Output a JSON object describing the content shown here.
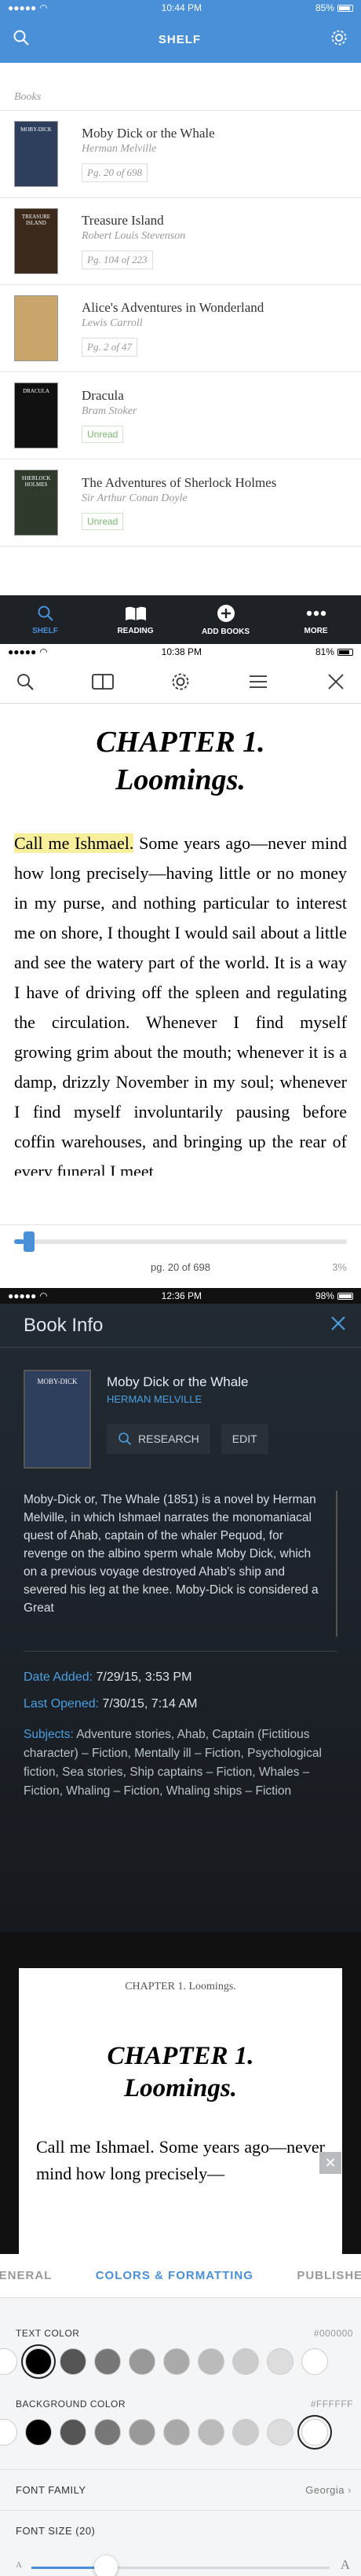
{
  "colors": {
    "accent": "#4a90d9",
    "unread": "#7bb86f",
    "highlight": "#f7ef9c",
    "tabbar": "#1e2227"
  },
  "shelf": {
    "status": {
      "time": "10:44 PM",
      "battery": "85%",
      "battery_level": 0.85
    },
    "title": "SHELF",
    "section_label": "Books",
    "books": [
      {
        "title": "Moby Dick or the Whale",
        "author": "Herman Melville",
        "badge": "Pg. 20 of 698",
        "unread": false,
        "cover_color": "#2d3f5c",
        "cover_text": "MOBY-DICK"
      },
      {
        "title": "Treasure Island",
        "author": "Robert Louis Stevenson",
        "badge": "Pg. 104 of 223",
        "unread": false,
        "cover_color": "#3b2a1c",
        "cover_text": "TREASURE ISLAND"
      },
      {
        "title": "Alice's Adventures in Wonderland",
        "author": "Lewis Carroll",
        "badge": "Pg. 2 of 47",
        "unread": false,
        "cover_color": "#c9a46b",
        "cover_text": ""
      },
      {
        "title": "Dracula",
        "author": "Bram Stoker",
        "badge": "Unread",
        "unread": true,
        "cover_color": "#111111",
        "cover_text": "DRACULA"
      },
      {
        "title": "The Adventures of Sherlock Holmes",
        "author": "Sir Arthur Conan Doyle",
        "badge": "Unread",
        "unread": true,
        "cover_color": "#2f3a2c",
        "cover_text": "SHERLOCK HOLMES"
      }
    ],
    "tabs": [
      {
        "label": "SHELF",
        "icon": "search-icon",
        "active": true
      },
      {
        "label": "READING",
        "icon": "open-book-icon",
        "active": false
      },
      {
        "label": "ADD BOOKS",
        "icon": "plus-circle-icon",
        "active": false
      },
      {
        "label": "MORE",
        "icon": "more-dots-icon",
        "active": false
      }
    ]
  },
  "reader": {
    "status": {
      "time": "10:38 PM",
      "battery": "81%",
      "battery_level": 0.81
    },
    "chapter_line1": "CHAPTER 1.",
    "chapter_line2": "Loomings.",
    "highlight_text": "Call me Ishmael.",
    "body_text": " Some years ago—never mind how long precisely—having little or no money in my purse, and nothing particular to interest me on shore, I thought I would sail about a little and see the watery part of the world. It is a way I have of driving off the spleen and regulating the circulation. Whenever I find myself growing grim about the mouth; whenever it is a damp, drizzly November in my soul; whenever I find myself involuntarily pausing before coffin warehouses, and bringing up the rear of every funeral I meet",
    "page_label": "pg. 20 of 698",
    "percent_label": "3%",
    "progress": 0.03
  },
  "info": {
    "status": {
      "time": "12:36 PM",
      "battery": "98%",
      "battery_level": 0.98
    },
    "header": "Book Info",
    "cover_text": "MOBY-DICK",
    "title": "Moby Dick or the Whale",
    "author": "HERMAN MELVILLE",
    "research_label": "RESEARCH",
    "edit_label": "EDIT",
    "description": "Moby-Dick or, The Whale (1851) is a novel by Herman Melville, in which Ishmael narrates the monomaniacal quest of Ahab, captain of the whaler Pequod, for revenge on the albino sperm whale Moby Dick, which on a previous voyage destroyed Ahab's ship and severed his leg at the knee. Moby-Dick is considered a Great",
    "date_added_label": "Date Added:",
    "date_added": "7/29/15, 3:53 PM",
    "last_opened_label": "Last Opened:",
    "last_opened": "7/30/15, 7:14 AM",
    "subjects_label": "Subjects:",
    "subjects": "Adventure stories, Ahab, Captain (Fictitious character) – Fiction, Mentally ill – Fiction, Psychological fiction, Sea stories, Ship captains – Fiction, Whales – Fiction, Whaling – Fiction, Whaling ships – Fiction"
  },
  "settings": {
    "preview_header": "CHAPTER 1. Loomings.",
    "preview_title1": "CHAPTER 1.",
    "preview_title2": "Loomings.",
    "preview_body": "Call me Ishmael. Some years ago—never mind how long precisely—",
    "tabs": [
      {
        "label": "GENERAL",
        "active": false
      },
      {
        "label": "COLORS & FORMATTING",
        "active": true
      },
      {
        "label": "PUBLISHER",
        "active": false
      }
    ],
    "text_color_label": "TEXT COLOR",
    "text_color_value": "#000000",
    "background_color_label": "BACKGROUND COLOR",
    "background_color_value": "#FFFFFF",
    "text_swatches": [
      "#ffffff",
      "#000000",
      "#555555",
      "#777777",
      "#999999",
      "#aaaaaa",
      "#bbbbbb",
      "#cccccc",
      "#dddddd",
      "#ffffff"
    ],
    "text_selected": 1,
    "bg_swatches": [
      "#ffffff",
      "#000000",
      "#555555",
      "#777777",
      "#999999",
      "#aaaaaa",
      "#bbbbbb",
      "#cccccc",
      "#dddddd",
      "#ffffff"
    ],
    "bg_selected": 9,
    "font_family_label": "FONT FAMILY",
    "font_family_value": "Georgia",
    "font_size_label": "FONT SIZE (20)",
    "font_size_fraction": 0.25,
    "size_small": "A",
    "size_large": "A"
  }
}
